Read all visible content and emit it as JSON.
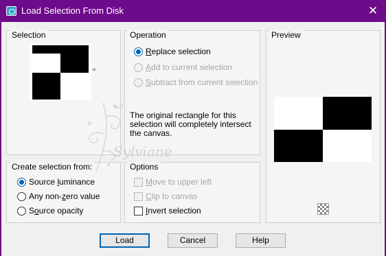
{
  "window": {
    "title": "Load Selection From Disk",
    "close_glyph": "✕"
  },
  "selection_group": {
    "title": "Selection"
  },
  "operation_group": {
    "title": "Operation",
    "options": [
      {
        "pre": "",
        "mnemonic": "R",
        "post": "eplace selection",
        "checked": true,
        "enabled": true
      },
      {
        "pre": "",
        "mnemonic": "A",
        "post": "dd to current selection",
        "checked": false,
        "enabled": false
      },
      {
        "pre": "",
        "mnemonic": "S",
        "post": "ubtract from current selection",
        "checked": false,
        "enabled": false
      }
    ],
    "info_line1": "The original rectangle for this",
    "info_line2": "selection will completely intersect",
    "info_line3": "the canvas."
  },
  "preview_group": {
    "title": "Preview",
    "toggle_icon": "checkerboard-icon"
  },
  "create_group": {
    "title": "Create selection from:",
    "options": [
      {
        "pre": "Source ",
        "mnemonic": "l",
        "post": "uminance",
        "checked": true
      },
      {
        "pre": "Any non-",
        "mnemonic": "z",
        "post": "ero value",
        "checked": false
      },
      {
        "pre": "S",
        "mnemonic": "o",
        "post": "urce opacity",
        "checked": false
      }
    ]
  },
  "options_group": {
    "title": "Options",
    "items": [
      {
        "pre": "",
        "mnemonic": "M",
        "post": "ove to upper left",
        "checked": false,
        "enabled": false
      },
      {
        "pre": "",
        "mnemonic": "C",
        "post": "lip to canvas",
        "checked": false,
        "enabled": false
      },
      {
        "pre": "",
        "mnemonic": "I",
        "post": "nvert selection",
        "checked": false,
        "enabled": true
      }
    ]
  },
  "buttons": {
    "load": "Load",
    "cancel": "Cancel",
    "help": "Help"
  },
  "watermark": {
    "text": "Sylviane"
  },
  "colors": {
    "title_bar": "#6d0b8a",
    "accent": "#0063b1"
  }
}
